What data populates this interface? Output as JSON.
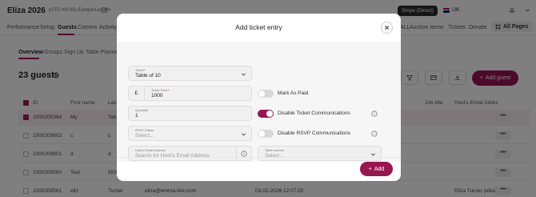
{
  "header": {
    "event_title": "Eliza 2026",
    "timezone": "(UTC+00:00) Europe/London",
    "stripe_badge": "Stripe (Direct)",
    "language": "UK"
  },
  "nav": {
    "items": [
      "Performance",
      "Setup",
      "Guests",
      "Comms",
      "Activity"
    ],
    "right_items": [
      "Auction Items",
      "Tickets",
      "Donate"
    ],
    "right_items_prefix": "ALL",
    "all_pages": "All Pages"
  },
  "subnav": {
    "items": [
      "Overview",
      "Groups",
      "Sign Up",
      "Table Planner"
    ]
  },
  "guests": {
    "title": "23 guests",
    "add_guest": "Add guest",
    "columns": {
      "id": "ID",
      "first_name": "First name",
      "last_name": "Las",
      "job_title": "Job title",
      "host_email": "Host's Email Addre"
    },
    "rows": [
      {
        "id": "1000200364",
        "first": "My",
        "last": "Tab",
        "checked": true
      },
      {
        "id": "1000200803",
        "first": "c",
        "last": "c",
        "checked": false
      },
      {
        "id": "1000200801",
        "first": "d",
        "last": "d",
        "checked": false
      },
      {
        "id": "1000200560",
        "first": "Test",
        "last": "553",
        "checked": false
      },
      {
        "id": "1000200561",
        "first": "eliz",
        "last": "Turner",
        "email": "eliza@emma-live.com",
        "date": "03-02-2026 12:07:20",
        "host": "Eliza Turner (elisa)",
        "checked": false
      }
    ],
    "more": "•••"
  },
  "modal": {
    "title": "Add ticket entry",
    "ticket": {
      "label": "Ticket",
      "value": "Table of 10"
    },
    "price": {
      "label": "Ticket Price",
      "currency": "£",
      "value": "1000"
    },
    "quantity": {
      "label": "Quantity",
      "value": "1"
    },
    "rsvp": {
      "label": "RSVP Status",
      "placeholder": "Select..."
    },
    "host_email": {
      "label": "Host's Email Address",
      "placeholder": "Search for Host's Email Address"
    },
    "table_number": {
      "label": "Table number",
      "placeholder": "Select..."
    },
    "toggles": {
      "mark_as_paid": {
        "label": "Mark As Paid",
        "on": false
      },
      "disable_ticket_comms": {
        "label": "Disable Ticket Communications",
        "on": true
      },
      "disable_rsvp_comms": {
        "label": "Disable RSVP Communications",
        "on": false
      }
    },
    "add_button": "Add"
  }
}
